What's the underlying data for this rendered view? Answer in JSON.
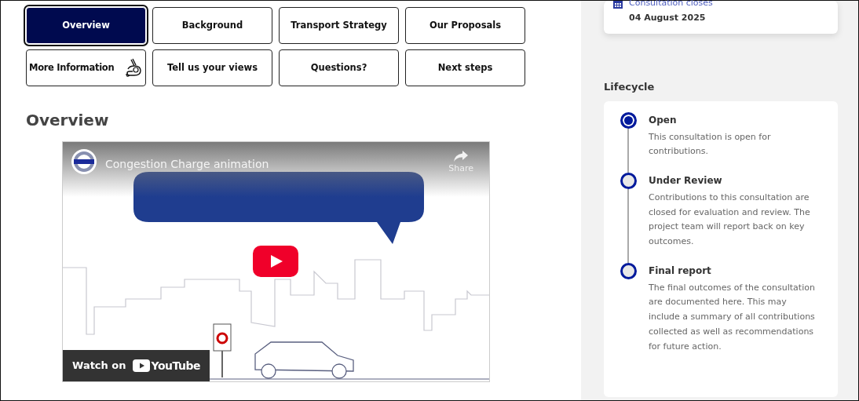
{
  "tabs": [
    {
      "label": "Overview",
      "selected": true,
      "kind": "plain"
    },
    {
      "label": "Background",
      "selected": false,
      "kind": "plain"
    },
    {
      "label": "Transport Strategy",
      "selected": false,
      "kind": "plain"
    },
    {
      "label": "Our Proposals",
      "selected": false,
      "kind": "plain"
    },
    {
      "label": "More Information",
      "selected": false,
      "kind": "sign-language"
    },
    {
      "label": "Tell us your views",
      "selected": false,
      "kind": "plain"
    },
    {
      "label": "Questions?",
      "selected": false,
      "kind": "plain"
    },
    {
      "label": "Next steps",
      "selected": false,
      "kind": "plain"
    }
  ],
  "section_title": "Overview",
  "video": {
    "title": "Congestion Charge animation",
    "share": "Share",
    "watch_on": "Watch on",
    "brand": "YouTube"
  },
  "dates_card": {
    "label": "Consultation closes",
    "date": "04 August 2025"
  },
  "lifecycle": {
    "title": "Lifecycle",
    "stages": [
      {
        "name": "Open",
        "description": "This consultation is open for contributions.",
        "current": true
      },
      {
        "name": "Under Review",
        "description": "Contributions to this consultation are closed for evaluation and review. The project team will report back on key outcomes.",
        "current": false
      },
      {
        "name": "Final report",
        "description": "The final outcomes of the consultation are documented here. This may include a summary of all contributions collected as well as recommendations for future action.",
        "current": false
      }
    ]
  }
}
